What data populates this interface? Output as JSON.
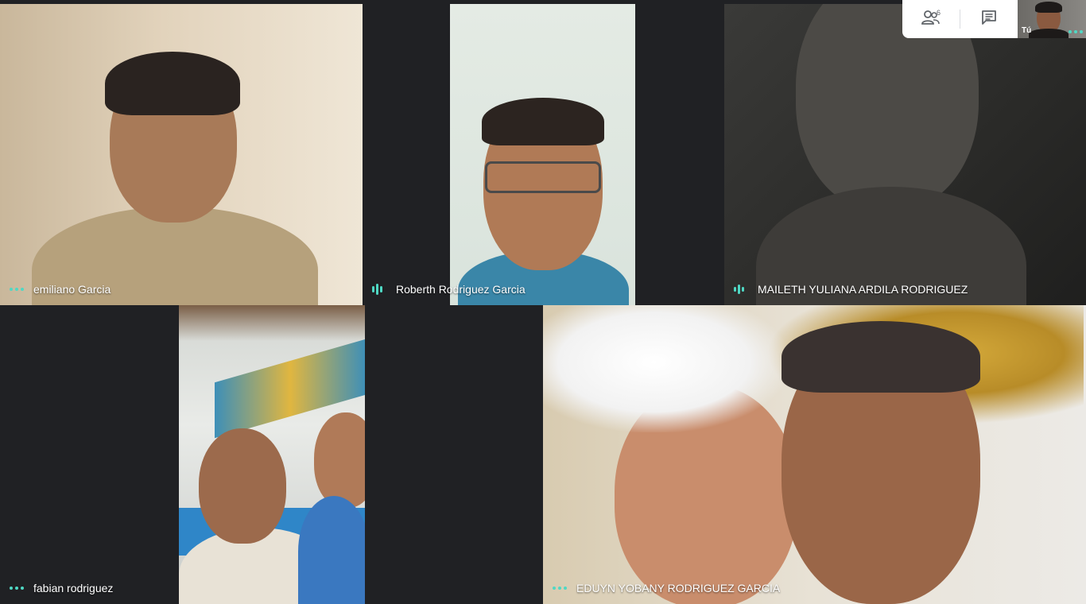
{
  "participants": [
    {
      "name": "emiliano Garcia",
      "indicator": "dots"
    },
    {
      "name": "Roberth Rodriguez Garcia",
      "indicator": "speaking"
    },
    {
      "name": "MAILETH YULIANA ARDILA RODRIGUEZ",
      "indicator": "speaking"
    },
    {
      "name": "fabian rodriguez",
      "indicator": "dots"
    },
    {
      "name": "EDUYN YOBANY RODRIGUEZ GARCIA",
      "indicator": "dots"
    }
  ],
  "controls": {
    "people_icon": "people-icon",
    "people_count": "6",
    "chat_icon": "chat-icon"
  },
  "self_view": {
    "label": "Tú"
  },
  "colors": {
    "background": "#202124",
    "dots_blue": "#8ab4f8",
    "indicator_teal": "#4fd8c4"
  }
}
